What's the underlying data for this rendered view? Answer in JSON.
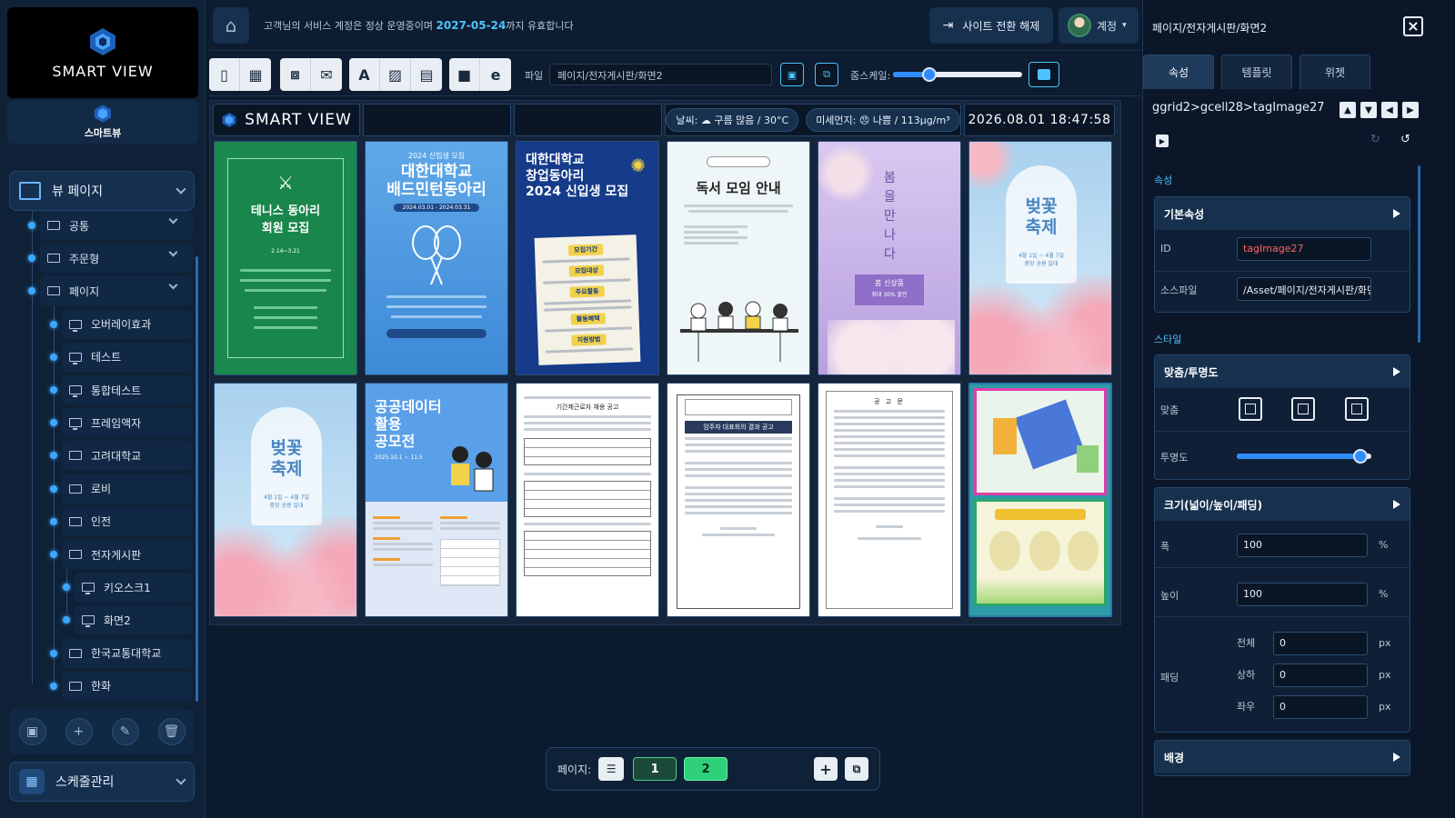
{
  "sidebar": {
    "logo_text": "SMART VIEW",
    "brand_label": "스마트뷰",
    "view_page_label": "뷰 페이지",
    "tree": [
      {
        "label": "공통",
        "type": "folder",
        "level": 1,
        "expandable": true
      },
      {
        "label": "주문형",
        "type": "folder",
        "level": 1,
        "expandable": true
      },
      {
        "label": "페이지",
        "type": "folder",
        "level": 1,
        "expandable": true
      },
      {
        "label": "오버레이효과",
        "type": "page",
        "level": 2
      },
      {
        "label": "테스트",
        "type": "page",
        "level": 2
      },
      {
        "label": "통합테스트",
        "type": "page",
        "level": 2
      },
      {
        "label": "프레임액자",
        "type": "page",
        "level": 2
      },
      {
        "label": "고려대학교",
        "type": "folder",
        "level": 2
      },
      {
        "label": "로비",
        "type": "folder",
        "level": 2
      },
      {
        "label": "인전",
        "type": "folder",
        "level": 2
      },
      {
        "label": "전자게시판",
        "type": "folder",
        "level": 2
      },
      {
        "label": "키오스크1",
        "type": "page",
        "level": 3
      },
      {
        "label": "화면2",
        "type": "page",
        "level": 3
      },
      {
        "label": "한국교통대학교",
        "type": "folder",
        "level": 2
      },
      {
        "label": "한화",
        "type": "folder",
        "level": 2
      }
    ],
    "tools": [
      "folder-add-icon",
      "plus-icon",
      "pencil-icon",
      "trash-icon"
    ],
    "schedule_label": "스케줄관리"
  },
  "topbar": {
    "notice_prefix": "고객님의 서비스 계정은 정상 운영중이며 ",
    "notice_date": "2027-05-24",
    "notice_suffix": "까지 유효합니다",
    "switch_label": "사이트 전환 해제",
    "account_label": "계정"
  },
  "toolbar": {
    "file_label": "파일",
    "file_path": "페이지/전자게시판/화면2",
    "zoom_label": "줌스케일:",
    "zoom_level": 0.28
  },
  "canvas": {
    "logo_text": "SMART VIEW",
    "weather": "날씨: ☁ 구름 많음 / 30°C",
    "dust": "미세먼지: 😠 나쁨 / 113μg/m³",
    "datetime": "2026.08.01  18:47:58",
    "posters": {
      "tennis_title": "테니스 동아리\n회원 모집",
      "tennis_date": "2.14~3.21",
      "badminton_year": "2024 신입생 모집",
      "badminton_title": "대한대학교\n배드민턴동아리",
      "badminton_period": "2024.03.01 - 2024.03.31",
      "startup_title": "대한대학교\n창업동아리\n2024 신입생 모집",
      "reading_title": "독서 모임 안내",
      "spring_title": "봄\n을\n만\n나\n다",
      "spring_tag": "봄 신상품",
      "spring_sub": "최대 30% 할인",
      "cherry_title": "벚꽃\n축제",
      "cherry_date": "4월 1일 ~ 4월 7일",
      "cherry_place": "중앙 공원 일대",
      "data_title": "공공데이터\n활용\n공모전",
      "data_period": "2025.10.1 ~ 11.5",
      "notice_title": "기간제근로자 채용 공고",
      "tenant_title": "임주자 대표회의 결과 공고",
      "memo_title": "공 고 문"
    }
  },
  "pagebar": {
    "label": "페이지:",
    "pages": [
      "1",
      "2"
    ],
    "active_page": "2"
  },
  "right_panel": {
    "title": "페이지/전자게시판/화면2",
    "tabs": [
      "속성",
      "템플릿",
      "위젯"
    ],
    "active_tab": "속성",
    "path": "ggrid2>gcell28>tagImage27",
    "section_props": "속성",
    "group_basic": "기본속성",
    "id_label": "ID",
    "id_value": "tagImage27",
    "source_label": "소스파일",
    "source_value": "/Asset/페이지/전자게시판/화면2",
    "section_style": "스타일",
    "group_fit": "맞춤/투명도",
    "fit_label": "맞춤",
    "opacity_label": "투명도",
    "opacity_level": 0.92,
    "group_size": "크기(넓이/높이/패딩)",
    "width_label": "폭",
    "width_value": "100",
    "height_label": "높이",
    "height_value": "100",
    "percent_unit": "%",
    "padding_label": "패딩",
    "pad_all_label": "전체",
    "pad_all_value": "0",
    "pad_tb_label": "상하",
    "pad_tb_value": "0",
    "pad_lr_label": "좌우",
    "pad_lr_value": "0",
    "px_unit": "px",
    "group_bg": "배경"
  }
}
